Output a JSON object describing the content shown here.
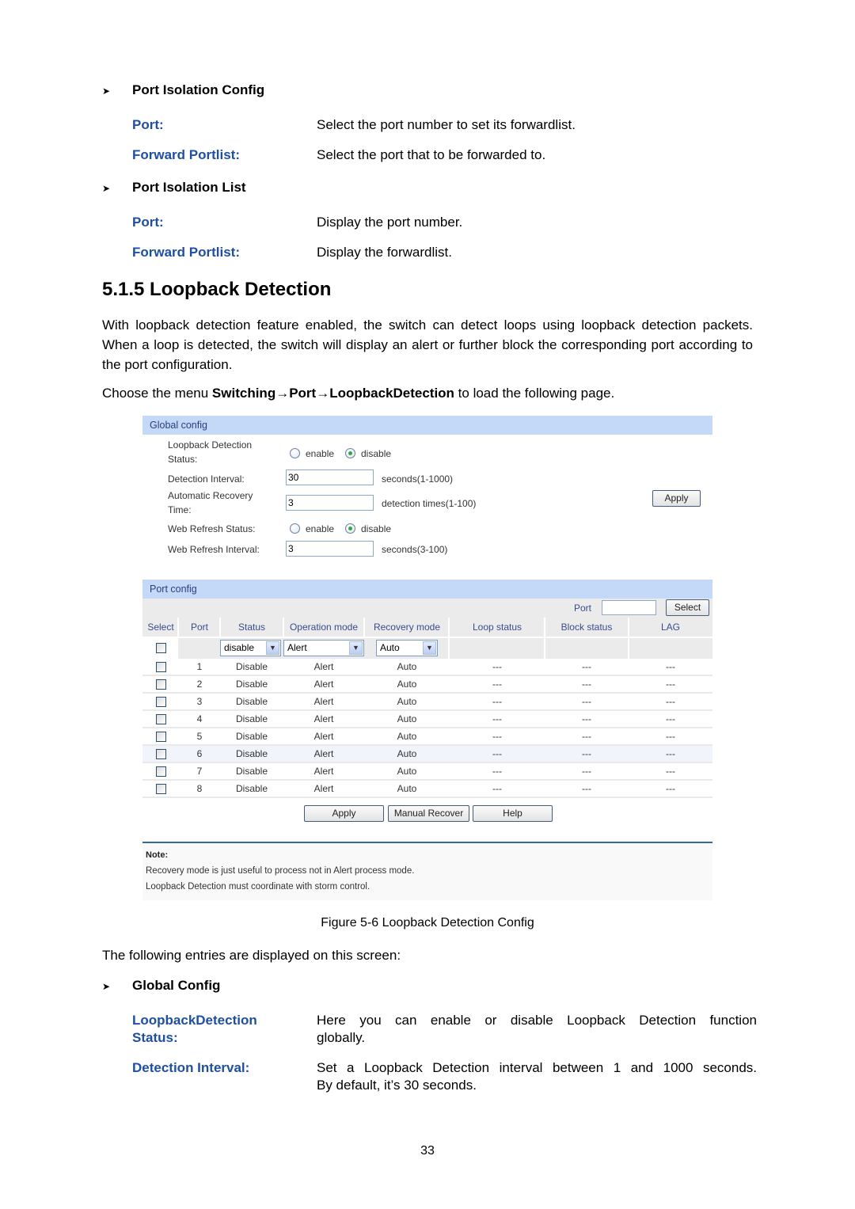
{
  "port_isolation_config": {
    "heading": "Port Isolation Config",
    "entries": [
      {
        "term": "Port:",
        "desc": "Select the port number to set its forwardlist."
      },
      {
        "term": "Forward Portlist:",
        "desc": "Select the port that to be forwarded to."
      }
    ]
  },
  "port_isolation_list": {
    "heading": "Port Isolation List",
    "entries": [
      {
        "term": "Port:",
        "desc": "Display the port number."
      },
      {
        "term": "Forward Portlist:",
        "desc": "Display the forwardlist."
      }
    ]
  },
  "section": {
    "title": "5.1.5 Loopback Detection",
    "intro": "With loopback detection feature enabled, the switch can detect loops using loopback detection packets. When a loop is detected, the switch will display an alert or further block the corresponding port according to the port configuration.",
    "menu_prefix": "Choose the menu ",
    "menu_path": "Switching→Port→LoopbackDetection",
    "menu_suffix": " to load the following page."
  },
  "figure": {
    "global_config": {
      "title": "Global config",
      "status_label_1": "Loopback Detection",
      "status_label_2": "Status:",
      "status_options": [
        "enable",
        "disable"
      ],
      "status_selected": "disable",
      "interval_label": "Detection Interval:",
      "interval_value": "30",
      "interval_hint": "seconds(1-1000)",
      "recovery_label_1": "Automatic Recovery",
      "recovery_label_2": "Time:",
      "recovery_value": "3",
      "recovery_hint": "detection times(1-100)",
      "web_refresh_status_label": "Web Refresh Status:",
      "web_refresh_options": [
        "enable",
        "disable"
      ],
      "web_refresh_selected": "disable",
      "web_refresh_interval_label": "Web Refresh Interval:",
      "web_refresh_interval_value": "3",
      "web_refresh_interval_hint": "seconds(3-100)",
      "apply_label": "Apply"
    },
    "port_config": {
      "title": "Port config",
      "port_search_label": "Port",
      "port_search_value": "",
      "select_button": "Select",
      "columns": [
        "Select",
        "Port",
        "Status",
        "Operation mode",
        "Recovery mode",
        "Loop status",
        "Block status",
        "LAG"
      ],
      "filter": {
        "status": "disable",
        "operation_mode": "Alert",
        "recovery_mode": "Auto"
      },
      "rows": [
        {
          "port": "1",
          "status": "Disable",
          "operation_mode": "Alert",
          "recovery_mode": "Auto",
          "loop_status": "---",
          "block_status": "---",
          "lag": "---"
        },
        {
          "port": "2",
          "status": "Disable",
          "operation_mode": "Alert",
          "recovery_mode": "Auto",
          "loop_status": "---",
          "block_status": "---",
          "lag": "---"
        },
        {
          "port": "3",
          "status": "Disable",
          "operation_mode": "Alert",
          "recovery_mode": "Auto",
          "loop_status": "---",
          "block_status": "---",
          "lag": "---"
        },
        {
          "port": "4",
          "status": "Disable",
          "operation_mode": "Alert",
          "recovery_mode": "Auto",
          "loop_status": "---",
          "block_status": "---",
          "lag": "---"
        },
        {
          "port": "5",
          "status": "Disable",
          "operation_mode": "Alert",
          "recovery_mode": "Auto",
          "loop_status": "---",
          "block_status": "---",
          "lag": "---"
        },
        {
          "port": "6",
          "status": "Disable",
          "operation_mode": "Alert",
          "recovery_mode": "Auto",
          "loop_status": "---",
          "block_status": "---",
          "lag": "---",
          "highlighted": true
        },
        {
          "port": "7",
          "status": "Disable",
          "operation_mode": "Alert",
          "recovery_mode": "Auto",
          "loop_status": "---",
          "block_status": "---",
          "lag": "---"
        },
        {
          "port": "8",
          "status": "Disable",
          "operation_mode": "Alert",
          "recovery_mode": "Auto",
          "loop_status": "---",
          "block_status": "---",
          "lag": "---"
        }
      ],
      "buttons": [
        "Apply",
        "Manual Recover",
        "Help"
      ]
    },
    "note": {
      "title": "Note:",
      "lines": [
        "Recovery mode is just useful to process not in Alert process mode.",
        "Loopback Detection must coordinate with storm control."
      ]
    },
    "caption": "Figure 5-6 Loopback Detection Config"
  },
  "entries_intro": "The following entries are displayed on this screen:",
  "global_config_desc": {
    "heading": "Global Config",
    "entries": [
      {
        "term_1": "LoopbackDetection",
        "term_2": "Status:",
        "desc_1": "Here you can enable or disable Loopback Detection function",
        "desc_2": "globally."
      },
      {
        "term_1": "Detection Interval:",
        "desc_1": "Set a Loopback Detection interval between 1 and 1000 seconds.",
        "desc_2": "By default, it’s 30 seconds."
      }
    ]
  },
  "page_number": "33",
  "colors": {
    "term_blue": "#1f4fa0",
    "bar_blue": "#c3d9f7",
    "header_text": "#3a4c8c",
    "note_rule": "#2d6aa0"
  }
}
